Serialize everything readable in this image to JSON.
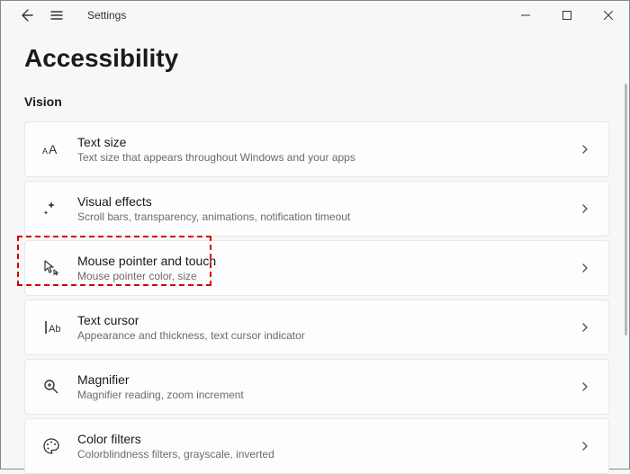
{
  "app": {
    "title": "Settings"
  },
  "page": {
    "title": "Accessibility"
  },
  "section": {
    "label": "Vision"
  },
  "items": [
    {
      "title": "Text size",
      "sub": "Text size that appears throughout Windows and your apps"
    },
    {
      "title": "Visual effects",
      "sub": "Scroll bars, transparency, animations, notification timeout"
    },
    {
      "title": "Mouse pointer and touch",
      "sub": "Mouse pointer color, size"
    },
    {
      "title": "Text cursor",
      "sub": "Appearance and thickness, text cursor indicator"
    },
    {
      "title": "Magnifier",
      "sub": "Magnifier reading, zoom increment"
    },
    {
      "title": "Color filters",
      "sub": "Colorblindness filters, grayscale, inverted"
    }
  ]
}
